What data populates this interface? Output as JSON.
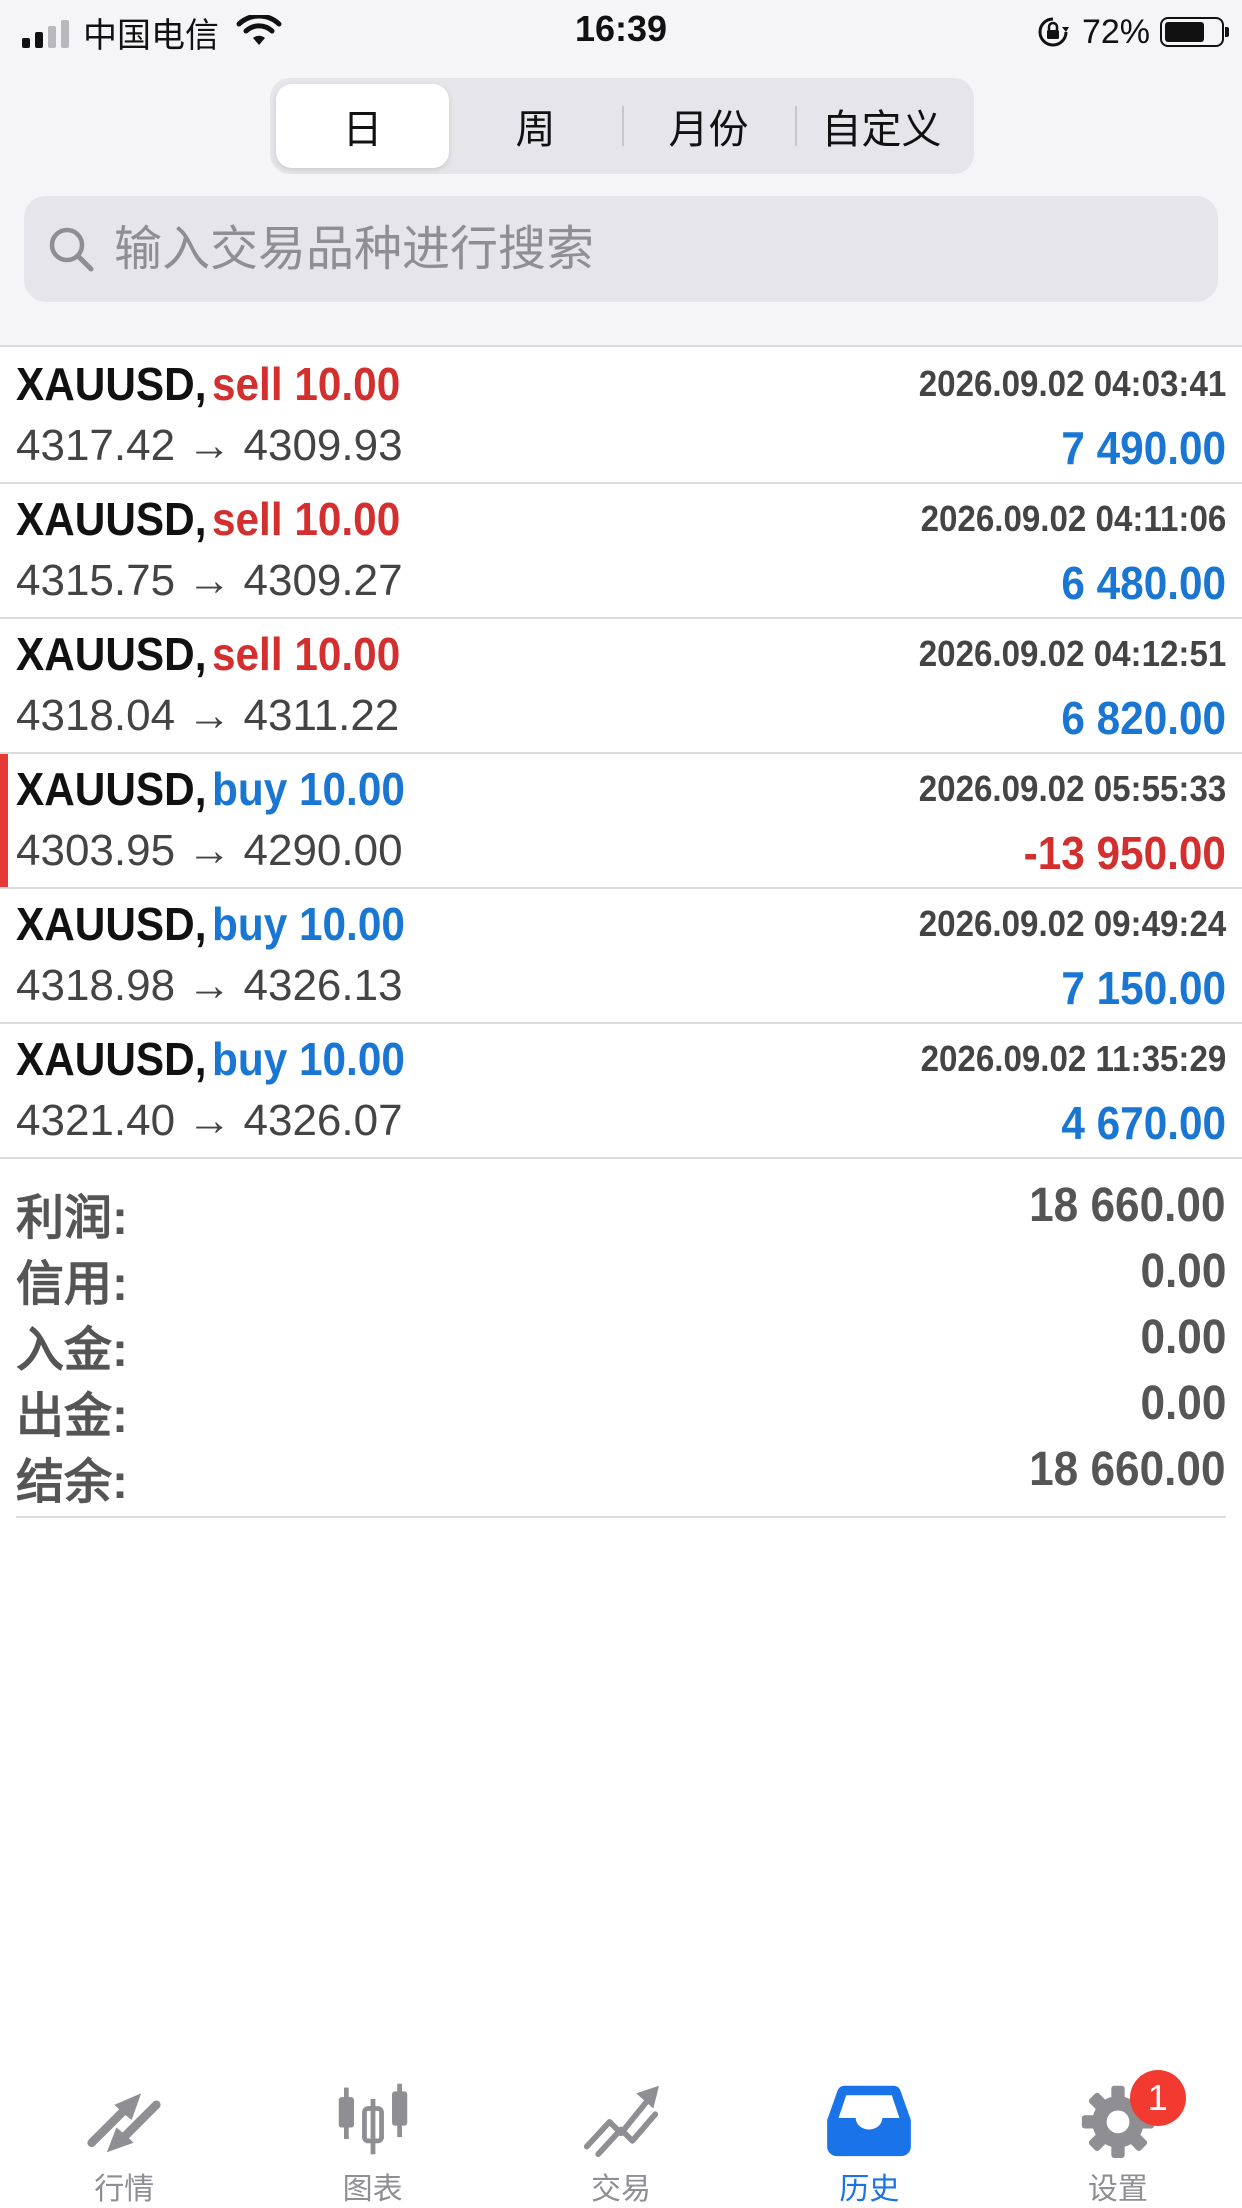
{
  "status_bar": {
    "carrier": "中国电信",
    "time": "16:39",
    "battery": "72%",
    "battery_level": 0.72
  },
  "period_tabs": {
    "items": [
      {
        "label": "日",
        "active": true
      },
      {
        "label": "周",
        "active": false
      },
      {
        "label": "月份",
        "active": false
      },
      {
        "label": "自定义",
        "active": false
      }
    ]
  },
  "search": {
    "placeholder": "输入交易品种进行搜索",
    "value": ""
  },
  "trades": [
    {
      "symbol": "XAUUSD,",
      "side": "sell 10.00",
      "side_type": "sell",
      "time": "2026.09.02 04:03:41",
      "prices": "4317.42 → 4309.93",
      "profit": "7 490.00",
      "profit_sign": "pos",
      "flagged": false
    },
    {
      "symbol": "XAUUSD,",
      "side": "sell 10.00",
      "side_type": "sell",
      "time": "2026.09.02 04:11:06",
      "prices": "4315.75 → 4309.27",
      "profit": "6 480.00",
      "profit_sign": "pos",
      "flagged": false
    },
    {
      "symbol": "XAUUSD,",
      "side": "sell 10.00",
      "side_type": "sell",
      "time": "2026.09.02 04:12:51",
      "prices": "4318.04 → 4311.22",
      "profit": "6 820.00",
      "profit_sign": "pos",
      "flagged": false
    },
    {
      "symbol": "XAUUSD,",
      "side": "buy 10.00",
      "side_type": "buy",
      "time": "2026.09.02 05:55:33",
      "prices": "4303.95 → 4290.00",
      "profit": "-13 950.00",
      "profit_sign": "neg",
      "flagged": true
    },
    {
      "symbol": "XAUUSD,",
      "side": "buy 10.00",
      "side_type": "buy",
      "time": "2026.09.02 09:49:24",
      "prices": "4318.98 → 4326.13",
      "profit": "7 150.00",
      "profit_sign": "pos",
      "flagged": false
    },
    {
      "symbol": "XAUUSD,",
      "side": "buy 10.00",
      "side_type": "buy",
      "time": "2026.09.02 11:35:29",
      "prices": "4321.40 → 4326.07",
      "profit": "4 670.00",
      "profit_sign": "pos",
      "flagged": false
    }
  ],
  "summary": [
    {
      "label": "利润:",
      "value": "18 660.00"
    },
    {
      "label": "信用:",
      "value": "0.00"
    },
    {
      "label": "入金:",
      "value": "0.00"
    },
    {
      "label": "出金:",
      "value": "0.00"
    },
    {
      "label": "结余:",
      "value": "18 660.00"
    }
  ],
  "tab_bar": {
    "items": [
      {
        "label": "行情",
        "icon": "quotes-icon",
        "active": false
      },
      {
        "label": "图表",
        "icon": "chart-candles-icon",
        "active": false
      },
      {
        "label": "交易",
        "icon": "trade-icon",
        "active": false
      },
      {
        "label": "历史",
        "icon": "history-inbox-icon",
        "active": true
      },
      {
        "label": "设置",
        "icon": "gear-icon",
        "active": false
      }
    ],
    "settings_badge": "1"
  },
  "colors": {
    "sell": "#d32f2f",
    "buy": "#1976d2",
    "profit_positive": "#1976d2",
    "profit_negative": "#d32f2f",
    "tab_active": "#1a73e8",
    "tab_inactive": "#8e8e93",
    "badge": "#f23a30"
  }
}
